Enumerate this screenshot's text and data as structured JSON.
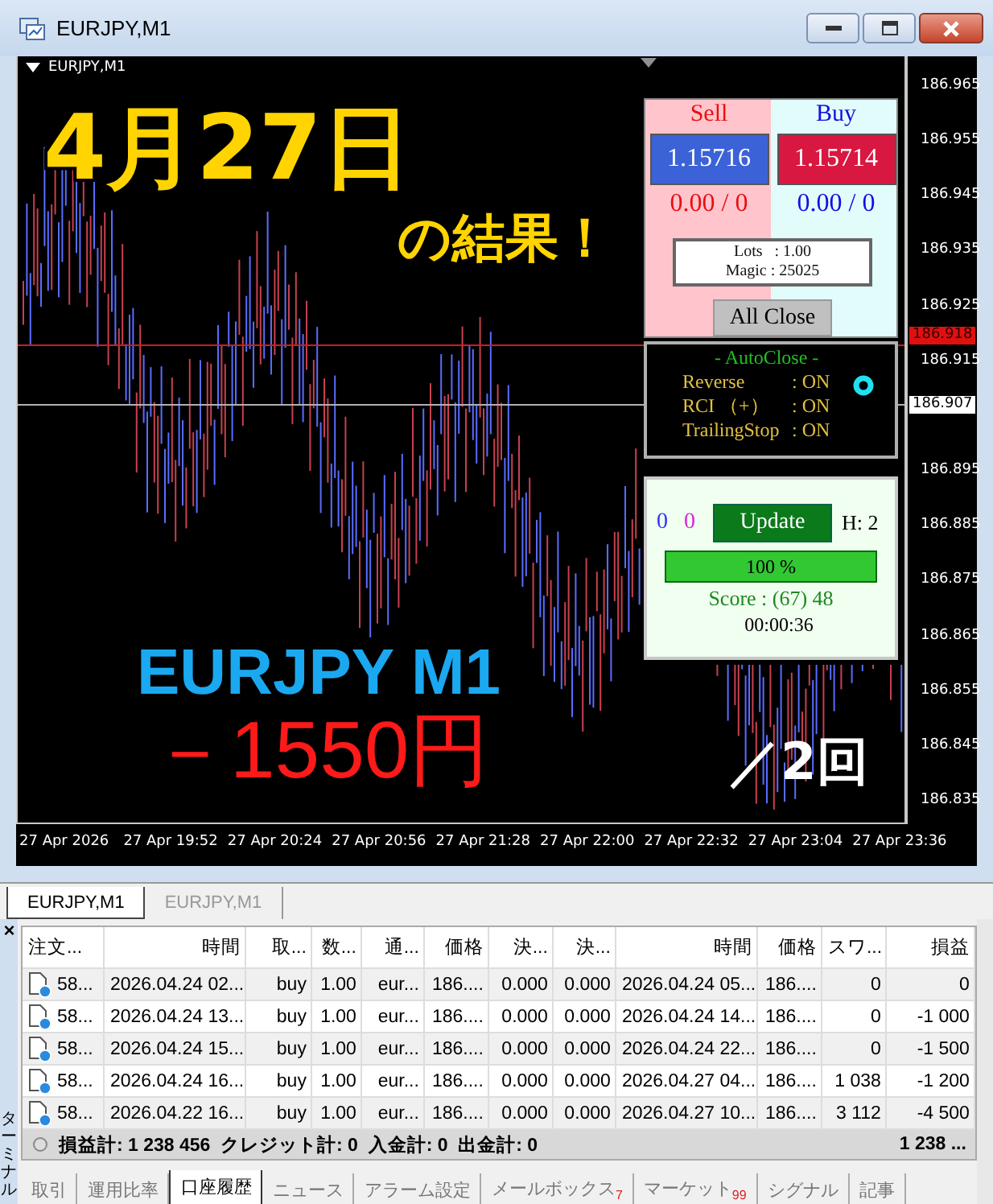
{
  "window": {
    "title": "EURJPY,M1"
  },
  "chart": {
    "symbol_label": "EURJPY,M1",
    "price_ticks": [
      "186.965",
      "186.955",
      "186.945",
      "186.935",
      "186.925",
      "186.915",
      "186.895",
      "186.885",
      "186.875",
      "186.865",
      "186.855",
      "186.845",
      "186.835"
    ],
    "time_ticks": [
      "27 Apr 2026",
      "27 Apr 19:52",
      "27 Apr 20:24",
      "27 Apr 20:56",
      "27 Apr 21:28",
      "27 Apr 22:00",
      "27 Apr 22:32",
      "27 Apr 23:04",
      "27 Apr 23:36"
    ],
    "bid_label": "186.918",
    "ask_label": "186.907",
    "overlay": {
      "date": "4月27日",
      "result": "の結果！",
      "pair": "EURJPY  M1",
      "profit": "－1550円",
      "count": "／2回"
    }
  },
  "trade_panel": {
    "sell": {
      "title": "Sell",
      "price": "1.15716",
      "position": "0.00 / 0"
    },
    "buy": {
      "title": "Buy",
      "price": "1.15714",
      "position": "0.00 / 0"
    },
    "info_lines": [
      "Lots   : 1.00",
      "Magic : 25025"
    ],
    "close_button": "All Close"
  },
  "autoclose_panel": {
    "title": "- AutoClose -",
    "rows": [
      {
        "label": "Reverse",
        "value": ": ON"
      },
      {
        "label": "RCI （+）",
        "value": ": ON"
      },
      {
        "label": "TrailingStop",
        "value": ": ON"
      }
    ]
  },
  "stats_panel": {
    "counts": [
      {
        "text": "0",
        "color": "#3030ff"
      },
      {
        "text": "0",
        "color": "#e020e0"
      }
    ],
    "update_button": "Update",
    "h_label": "H: 2",
    "progress": {
      "level": 1,
      "label": "100 %"
    },
    "score": "Score : (67) 48",
    "timer": "00:00:36"
  },
  "chart_tabs": [
    {
      "label": "EURJPY,M1",
      "selected": true
    },
    {
      "label": "EURJPY,M1",
      "selected": false
    }
  ],
  "terminal": {
    "title": "ターミナル",
    "close": "×",
    "columns": [
      "注文...",
      "時間",
      "取...",
      "数...",
      "通...",
      "価格",
      "決...",
      "決...",
      "時間",
      "価格",
      "スワ...",
      "損益"
    ],
    "rows": [
      [
        "58...",
        "2026.04.24 02...",
        "buy",
        "1.00",
        "eur...",
        "186....",
        "0.000",
        "0.000",
        "2026.04.24 05...",
        "186....",
        "0",
        "0"
      ],
      [
        "58...",
        "2026.04.24 13...",
        "buy",
        "1.00",
        "eur...",
        "186....",
        "0.000",
        "0.000",
        "2026.04.24 14...",
        "186....",
        "0",
        "-1 000"
      ],
      [
        "58...",
        "2026.04.24 15...",
        "buy",
        "1.00",
        "eur...",
        "186....",
        "0.000",
        "0.000",
        "2026.04.24 22...",
        "186....",
        "0",
        "-1 500"
      ],
      [
        "58...",
        "2026.04.24 16...",
        "buy",
        "1.00",
        "eur...",
        "186....",
        "0.000",
        "0.000",
        "2026.04.27 04...",
        "186....",
        "1 038",
        "-1 200"
      ],
      [
        "58...",
        "2026.04.22 16...",
        "buy",
        "1.00",
        "eur...",
        "186....",
        "0.000",
        "0.000",
        "2026.04.27 10...",
        "186....",
        "3 112",
        "-4 500"
      ]
    ],
    "summary": {
      "text": "損益計: 1 238 456  クレジット計: 0  入金計: 0  出金計: 0",
      "total": "1 238 ..."
    },
    "tabs": [
      {
        "label": "取引",
        "selected": false
      },
      {
        "label": "運用比率",
        "selected": false
      },
      {
        "label": "口座履歴",
        "selected": true
      },
      {
        "label": "ニュース",
        "selected": false
      },
      {
        "label": "アラーム設定",
        "selected": false
      },
      {
        "label": "メールボックス",
        "badge": "7",
        "selected": false
      },
      {
        "label": "マーケット",
        "badge": "99",
        "selected": false
      },
      {
        "label": "シグナル",
        "selected": false
      },
      {
        "label": "記事",
        "selected": false
      }
    ]
  }
}
